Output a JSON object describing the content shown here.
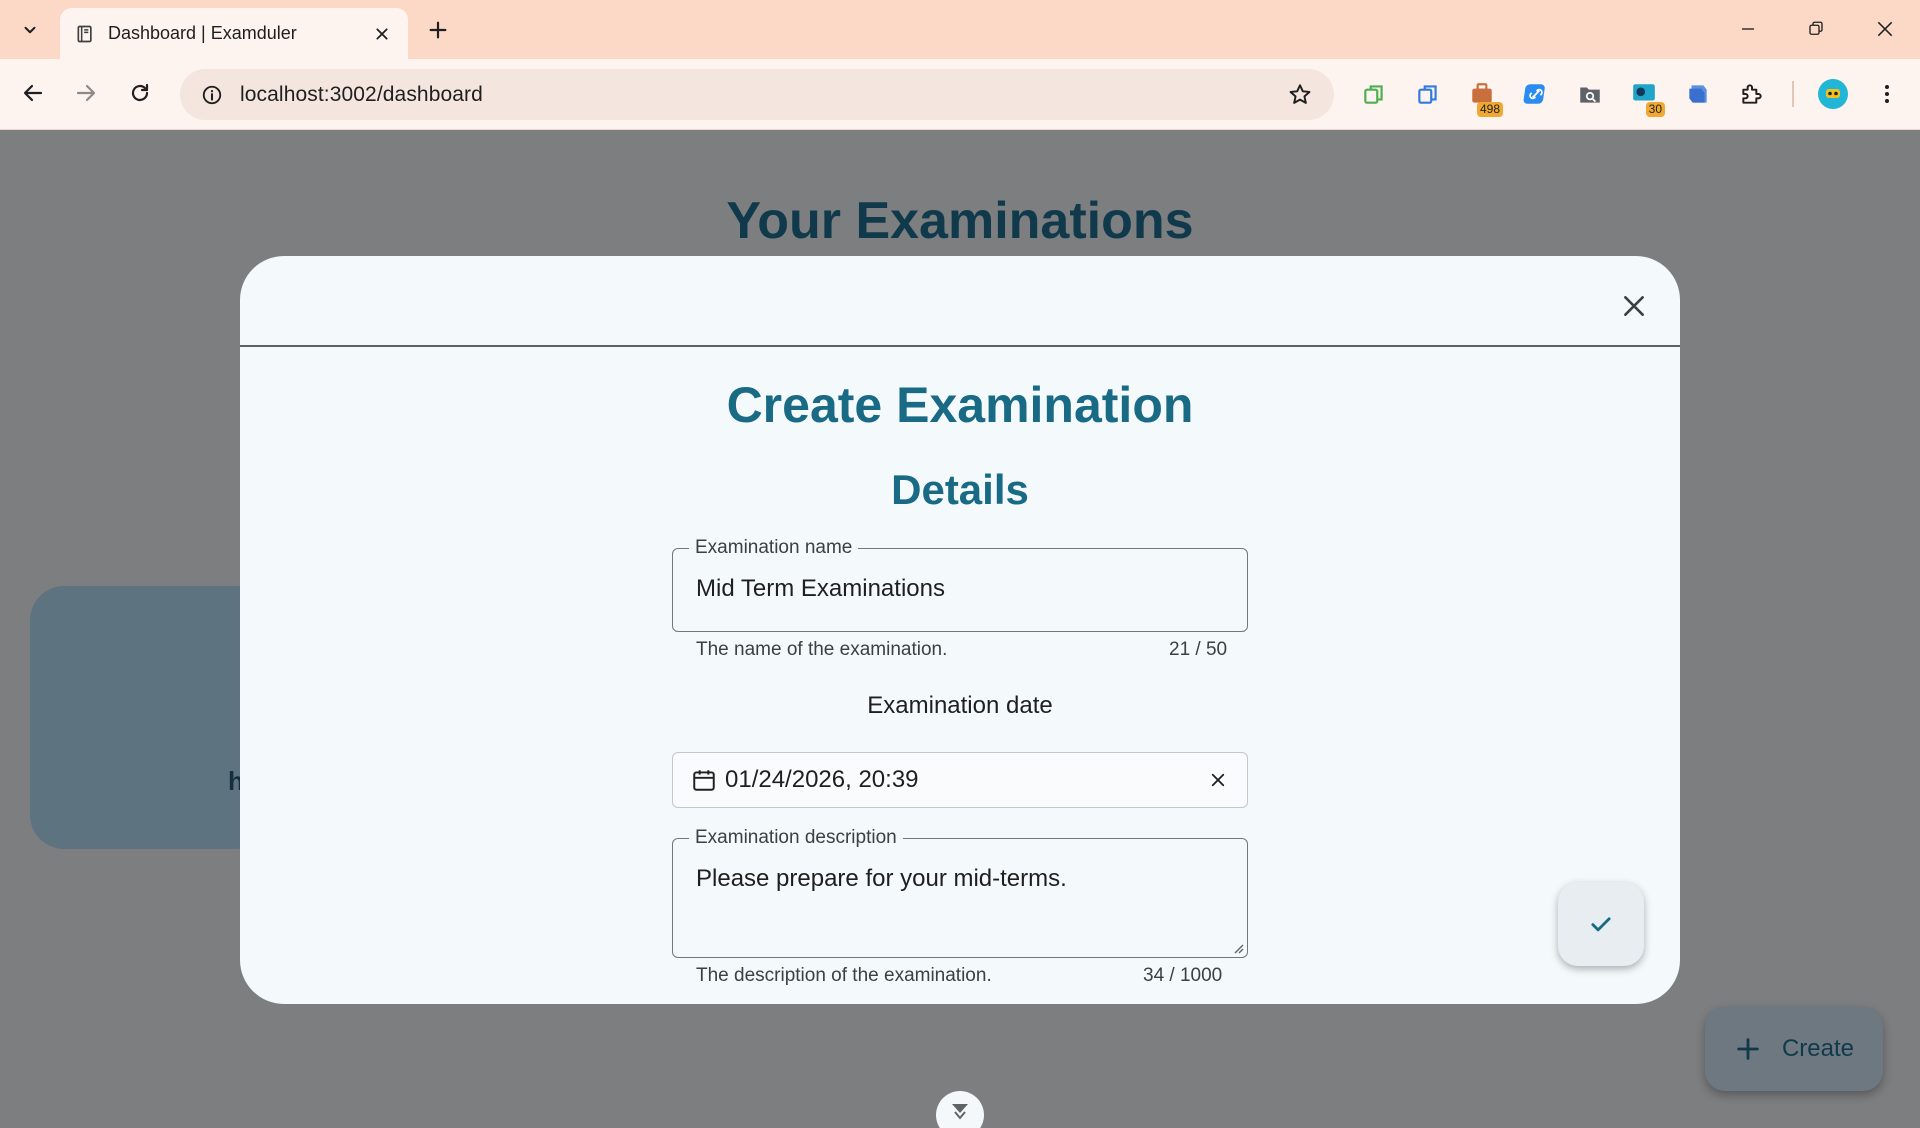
{
  "browser": {
    "tab_title": "Dashboard | Examduler",
    "url": "localhost:3002/dashboard",
    "extensions": [
      {
        "icon": "ext-copy-green-icon",
        "badge": ""
      },
      {
        "icon": "ext-copy-blue-icon",
        "badge": ""
      },
      {
        "icon": "ext-bag-icon",
        "badge": "498"
      },
      {
        "icon": "ext-link-icon",
        "badge": ""
      },
      {
        "icon": "ext-search-folder-icon",
        "badge": ""
      },
      {
        "icon": "ext-monitor-icon",
        "badge": "30"
      },
      {
        "icon": "ext-layers-icon",
        "badge": ""
      },
      {
        "icon": "extensions-puzzle-icon",
        "badge": ""
      }
    ]
  },
  "page": {
    "title": "Your Examinations",
    "card_fragment": "h",
    "create_label": "Create"
  },
  "dialog": {
    "title": "Create Examination",
    "section": "Details",
    "name_field": {
      "label": "Examination name",
      "value": "Mid Term Examinations",
      "helper": "The name of the examination.",
      "counter": "21 / 50"
    },
    "date_field": {
      "label": "Examination date",
      "value": "01/24/2026, 20:39"
    },
    "description_field": {
      "label": "Examination description",
      "value": "Please prepare for your mid-terms.",
      "helper": "The description of the examination.",
      "counter": "34 / 1000"
    }
  },
  "colors": {
    "accent": "#196a85",
    "heading_dark": "#103a4b",
    "chrome_tabbar": "#fcd9c6",
    "chrome_toolbar": "#fdf3ef"
  }
}
